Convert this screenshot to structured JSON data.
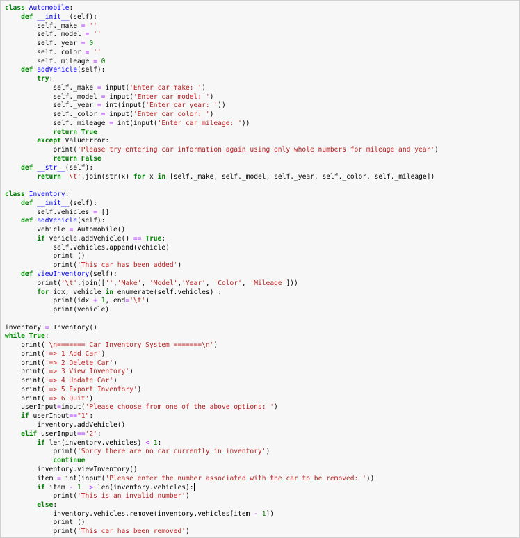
{
  "theme": {
    "keyword_color": "#008000",
    "definition_color": "#0000ff",
    "string_color": "#ba2121",
    "number_color": "#008000",
    "operator_color": "#aa22ff",
    "background": "#f7f7f7"
  },
  "lines": [
    "class Automobile:",
    "    def __init__(self):",
    "        self._make = ''",
    "        self._model = ''",
    "        self._year = 0",
    "        self._color = ''",
    "        self._mileage = 0",
    "    def addVehicle(self):",
    "        try:",
    "            self._make = input('Enter car make: ')",
    "            self._model = input('Enter car model: ')",
    "            self._year = int(input('Enter car year: '))",
    "            self._color = input('Enter car color: ')",
    "            self._mileage = int(input('Enter car mileage: '))",
    "            return True",
    "        except ValueError:",
    "            print('Please try entering car information again using only whole numbers for mileage and year')",
    "            return False",
    "    def __str__(self):",
    "        return '\\t'.join(str(x) for x in [self._make, self._model, self._year, self._color, self._mileage])",
    "",
    "class Inventory:",
    "    def __init__(self):",
    "        self.vehicles = []",
    "    def addVehicle(self):",
    "        vehicle = Automobile()",
    "        if vehicle.addVehicle() == True:",
    "            self.vehicles.append(vehicle)",
    "            print ()",
    "            print('This car has been added')",
    "    def viewInventory(self):",
    "        print('\\t'.join(['','Make', 'Model','Year', 'Color', 'Mileage']))",
    "        for idx, vehicle in enumerate(self.vehicles) :",
    "            print(idx + 1, end='\\t')",
    "            print(vehicle)",
    "",
    "inventory = Inventory()",
    "while True:",
    "    print('\\n======= Car Inventory System =======\\n')",
    "    print('=> 1 Add Car')",
    "    print('=> 2 Delete Car')",
    "    print('=> 3 View Inventory')",
    "    print('=> 4 Update Car')",
    "    print('=> 5 Export Inventory')",
    "    print('=> 6 Quit')",
    "    userInput=input('Please choose from one of the above options: ')",
    "    if userInput==\"1\":",
    "        inventory.addVehicle()",
    "    elif userInput=='2':",
    "        if len(inventory.vehicles) < 1:",
    "            print('Sorry there are no car currently in inventory')",
    "            continue",
    "        inventory.viewInventory()",
    "        item = int(input('Please enter the number associated with the car to be removed: '))",
    "        if item - 1  > len(inventory.vehicles):",
    "            print('This is an invalid number')",
    "        else:",
    "            inventory.vehicles.remove(inventory.vehicles[item - 1])",
    "            print ()",
    "            print('This car has been removed')"
  ],
  "cursor_line": 54
}
